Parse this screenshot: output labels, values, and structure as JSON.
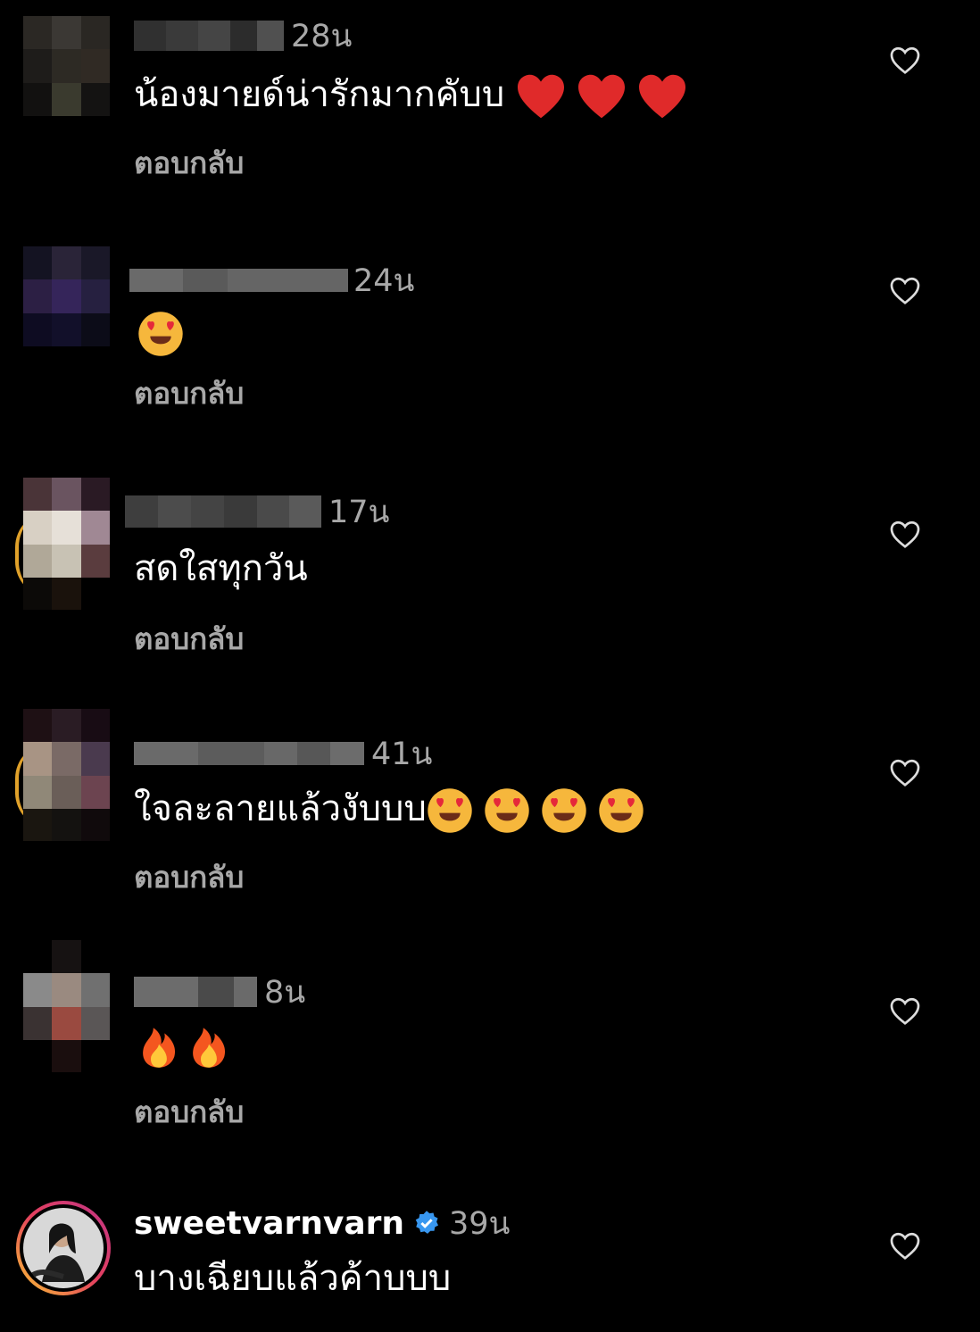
{
  "comments": [
    {
      "time": "28น",
      "text": "น้องมายด์น่ารักมากคับบ",
      "emoji": "❤️ ❤️ ❤️",
      "reply": "ตอบกลับ"
    },
    {
      "time": "24น",
      "text": "",
      "emoji": "😍",
      "reply": "ตอบกลับ"
    },
    {
      "time": "17น",
      "text": "สดใสทุกวัน",
      "emoji": "",
      "reply": "ตอบกลับ"
    },
    {
      "time": "41น",
      "text": "ใจละลายแล้วงับบบ",
      "emoji": "😍 😍 😍 😍",
      "reply": "ตอบกลับ"
    },
    {
      "time": "8น",
      "text": "",
      "emoji": "🔥 🔥",
      "reply": "ตอบกลับ"
    },
    {
      "username": "sweetvarnvarn",
      "time": "39น",
      "text": "บางเฉียบแล้วค้าบบบ",
      "reply": ""
    }
  ],
  "colors": {
    "background": "#000000",
    "secondary_text": "#a8a8a8",
    "verified": "#3897f0",
    "story_ring": "#e0a12a"
  }
}
